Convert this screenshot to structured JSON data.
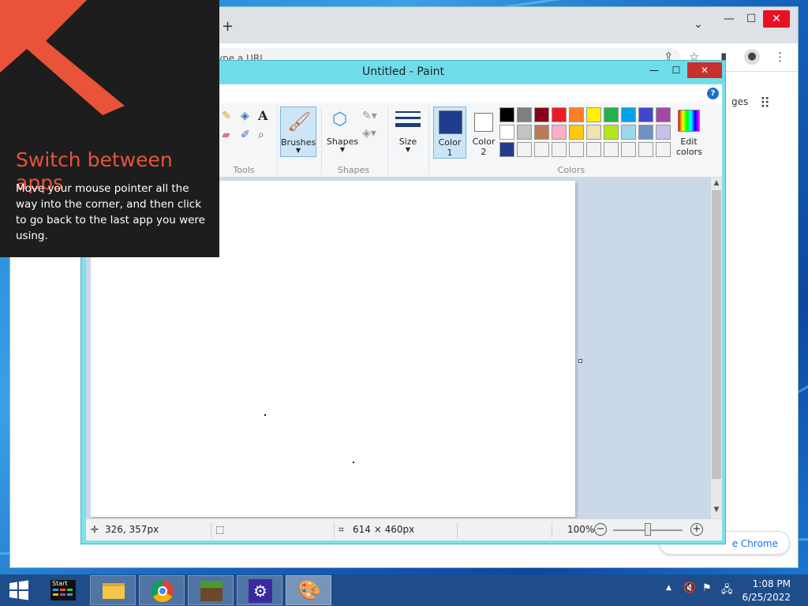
{
  "chrome": {
    "new_tab": "+",
    "tab_dropdown": "⌄",
    "minimize": "—",
    "maximize": "☐",
    "close": "✕",
    "omnibox_placeholder": "ype a URL",
    "side_text": "ges",
    "customize_label": "e Chrome"
  },
  "paint": {
    "title": "Untitled - Paint",
    "minimize": "—",
    "maximize": "☐",
    "close": "✕",
    "help": "?",
    "groups": {
      "tools": "Tools",
      "shapes": "Shapes",
      "colors": "Colors"
    },
    "buttons": {
      "brushes": "Brushes",
      "shapes": "Shapes",
      "size": "Size",
      "color1_line1": "Color",
      "color1_line2": "1",
      "color2_line1": "Color",
      "color2_line2": "2",
      "edit_line1": "Edit",
      "edit_line2": "colors"
    },
    "color1": "#1f3d8c",
    "color2": "#ffffff",
    "palette_row1": [
      "#000000",
      "#7f7f7f",
      "#880015",
      "#ed1c24",
      "#ff7f27",
      "#fff200",
      "#22b14c",
      "#00a2e8",
      "#3f48cc",
      "#a349a4"
    ],
    "palette_row2": [
      "#ffffff",
      "#c3c3c3",
      "#b97a57",
      "#ffaec9",
      "#ffc90e",
      "#efe4b0",
      "#b5e61d",
      "#99d9ea",
      "#7092be",
      "#c8bfe7"
    ],
    "palette_row3": [
      "#1f3d8c",
      "#f3f3f3",
      "#f3f3f3",
      "#f3f3f3",
      "#f3f3f3",
      "#f3f3f3",
      "#f3f3f3",
      "#f3f3f3",
      "#f3f3f3",
      "#f3f3f3"
    ],
    "status": {
      "cursor_pos": "326, 357px",
      "canvas_size": "614 × 460px",
      "zoom": "100%"
    }
  },
  "tip": {
    "title": "Switch between apps",
    "body": "Move your mouse pointer all the way into the corner, and then click to go back to the last app you were using."
  },
  "taskbar": {
    "start_tile_label": "Start",
    "time": "1:08 PM",
    "date": "6/25/2022"
  }
}
